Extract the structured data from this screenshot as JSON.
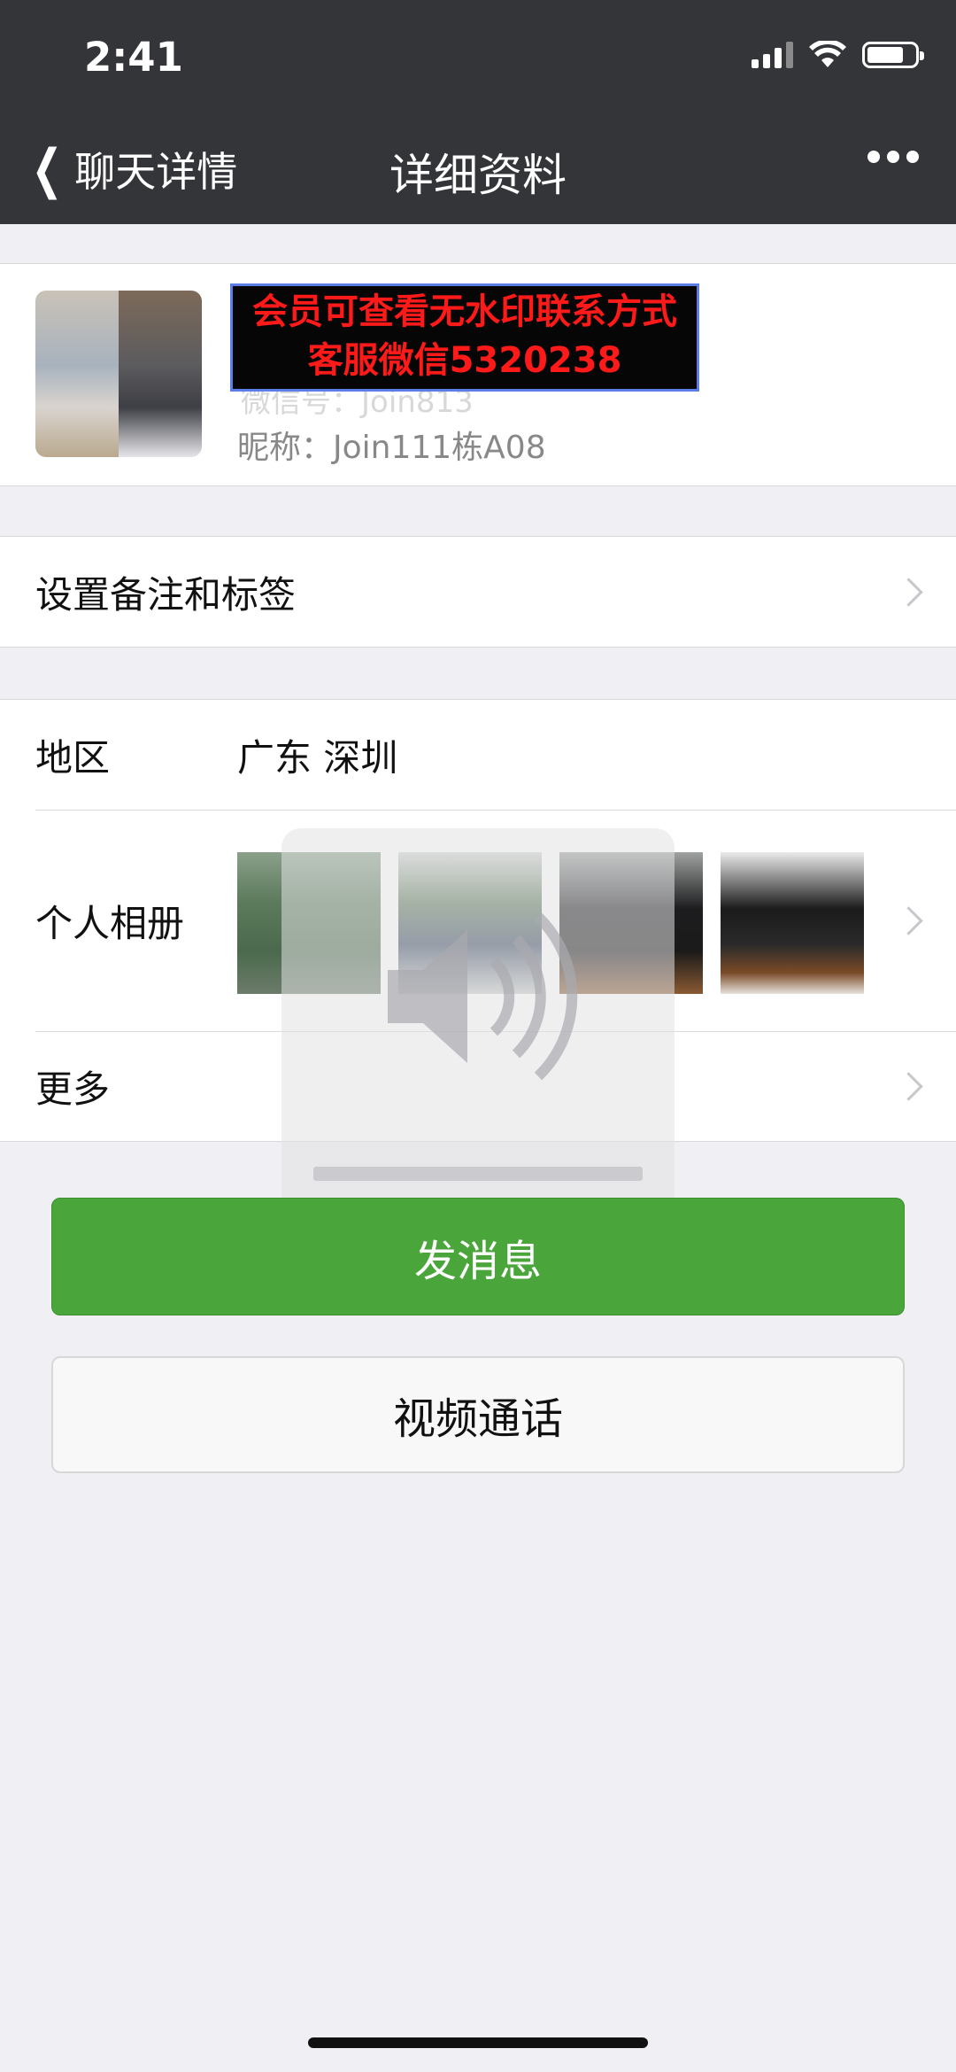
{
  "status_bar": {
    "time": "2:41"
  },
  "nav": {
    "back_label": "聊天详情",
    "title": "详细资料"
  },
  "profile": {
    "banner_line1": "会员可查看无水印联系方式",
    "banner_line2": "客服微信5320238",
    "wechat_id": "微信号：Join813",
    "nickname": "昵称：Join111栋A08"
  },
  "rows": {
    "remark_label": "设置备注和标签",
    "region_label": "地区",
    "region_value": "广东 深圳",
    "album_label": "个人相册",
    "more_label": "更多"
  },
  "buttons": {
    "send_message": "发消息",
    "video_call": "视频通话"
  },
  "colors": {
    "nav_bg": "#333539",
    "page_bg": "#efeff4",
    "primary_green": "#4aa53a",
    "banner_text": "#ff1a1a"
  }
}
